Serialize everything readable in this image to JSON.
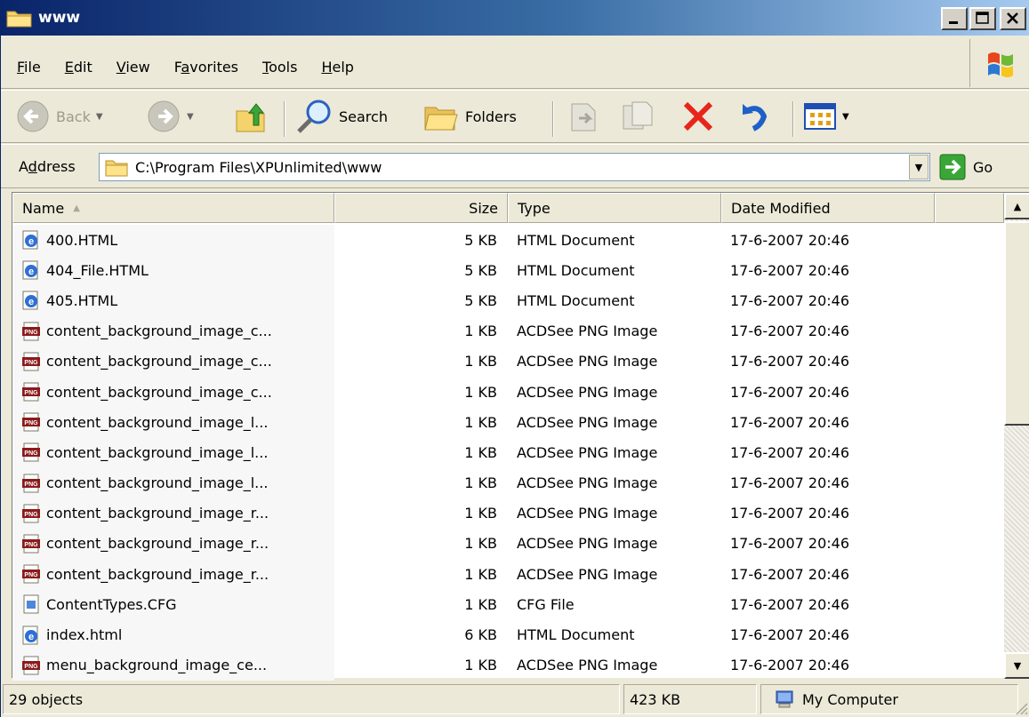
{
  "window": {
    "title": "www"
  },
  "menu": {
    "items": [
      {
        "label": "File",
        "accel": "F",
        "rest": "ile"
      },
      {
        "label": "Edit",
        "accel": "E",
        "rest": "dit"
      },
      {
        "label": "View",
        "accel": "V",
        "rest": "iew"
      },
      {
        "label": "Favorites",
        "accel": "a",
        "pre": "F",
        "rest": "vorites"
      },
      {
        "label": "Tools",
        "accel": "T",
        "rest": "ools"
      },
      {
        "label": "Help",
        "accel": "H",
        "rest": "elp"
      }
    ]
  },
  "toolbar": {
    "back_label": "Back",
    "search_label": "Search",
    "folders_label": "Folders"
  },
  "address": {
    "label_pre": "A",
    "label_accel": "d",
    "label_rest": "dress",
    "value": "C:\\Program Files\\XPUnlimited\\www",
    "go_label": "Go"
  },
  "columns": [
    "Name",
    "Size",
    "Type",
    "Date Modified"
  ],
  "files": [
    {
      "name": "400.HTML",
      "size": "5 KB",
      "type": "HTML Document",
      "date": "17-6-2007 20:46",
      "icon": "ie-html-icon"
    },
    {
      "name": "404_File.HTML",
      "size": "5 KB",
      "type": "HTML Document",
      "date": "17-6-2007 20:46",
      "icon": "ie-html-icon"
    },
    {
      "name": "405.HTML",
      "size": "5 KB",
      "type": "HTML Document",
      "date": "17-6-2007 20:46",
      "icon": "ie-html-icon"
    },
    {
      "name": "content_background_image_c...",
      "size": "1 KB",
      "type": "ACDSee PNG Image",
      "date": "17-6-2007 20:46",
      "icon": "png-icon"
    },
    {
      "name": "content_background_image_c...",
      "size": "1 KB",
      "type": "ACDSee PNG Image",
      "date": "17-6-2007 20:46",
      "icon": "png-icon"
    },
    {
      "name": "content_background_image_c...",
      "size": "1 KB",
      "type": "ACDSee PNG Image",
      "date": "17-6-2007 20:46",
      "icon": "png-icon"
    },
    {
      "name": "content_background_image_l...",
      "size": "1 KB",
      "type": "ACDSee PNG Image",
      "date": "17-6-2007 20:46",
      "icon": "png-icon"
    },
    {
      "name": "content_background_image_l...",
      "size": "1 KB",
      "type": "ACDSee PNG Image",
      "date": "17-6-2007 20:46",
      "icon": "png-icon"
    },
    {
      "name": "content_background_image_l...",
      "size": "1 KB",
      "type": "ACDSee PNG Image",
      "date": "17-6-2007 20:46",
      "icon": "png-icon"
    },
    {
      "name": "content_background_image_r...",
      "size": "1 KB",
      "type": "ACDSee PNG Image",
      "date": "17-6-2007 20:46",
      "icon": "png-icon"
    },
    {
      "name": "content_background_image_r...",
      "size": "1 KB",
      "type": "ACDSee PNG Image",
      "date": "17-6-2007 20:46",
      "icon": "png-icon"
    },
    {
      "name": "content_background_image_r...",
      "size": "1 KB",
      "type": "ACDSee PNG Image",
      "date": "17-6-2007 20:46",
      "icon": "png-icon"
    },
    {
      "name": "ContentTypes.CFG",
      "size": "1 KB",
      "type": "CFG File",
      "date": "17-6-2007 20:46",
      "icon": "cfg-icon"
    },
    {
      "name": "index.html",
      "size": "6 KB",
      "type": "HTML Document",
      "date": "17-6-2007 20:46",
      "icon": "ie-html-icon"
    },
    {
      "name": "menu_background_image_ce...",
      "size": "1 KB",
      "type": "ACDSee PNG Image",
      "date": "17-6-2007 20:46",
      "icon": "png-icon"
    }
  ],
  "status": {
    "objects": "29 objects",
    "size": "423 KB",
    "location": "My Computer"
  }
}
